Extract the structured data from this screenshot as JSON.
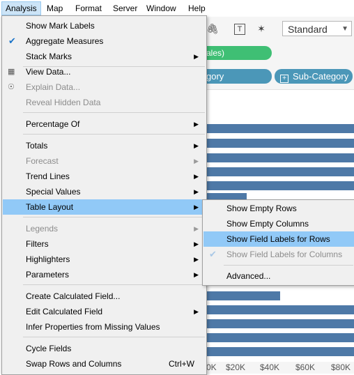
{
  "menubar": {
    "items": [
      {
        "label": "Analysis",
        "active": true
      },
      {
        "label": "Map"
      },
      {
        "label": "Format"
      },
      {
        "label": "Server"
      },
      {
        "label": "Window"
      },
      {
        "label": "Help"
      }
    ]
  },
  "toolbar": {
    "standard_select": "Standard"
  },
  "shelves": {
    "green_pill": "ales)",
    "category_pill": "gory",
    "subcategory_pill": "Sub-Category"
  },
  "axis_ticks": [
    "0K",
    "$20K",
    "$40K",
    "$60K",
    "$80K"
  ],
  "analysis_menu": {
    "items": [
      {
        "label": "Show Mark Labels"
      },
      {
        "label": "Aggregate Measures",
        "checked": true
      },
      {
        "label": "Stack Marks",
        "submenu": true
      },
      {
        "label": "View Data...",
        "icon": "table-icon"
      },
      {
        "label": "Explain Data...",
        "disabled": true,
        "icon": "lightbulb-icon"
      },
      {
        "label": "Reveal Hidden Data",
        "disabled": true
      },
      {
        "label": "Percentage Of",
        "submenu": true
      },
      {
        "label": "Totals",
        "submenu": true
      },
      {
        "label": "Forecast",
        "submenu": true,
        "disabled": true
      },
      {
        "label": "Trend Lines",
        "submenu": true
      },
      {
        "label": "Special Values",
        "submenu": true
      },
      {
        "label": "Table Layout",
        "submenu": true,
        "highlighted": true
      },
      {
        "label": "Legends",
        "submenu": true,
        "disabled": true
      },
      {
        "label": "Filters",
        "submenu": true
      },
      {
        "label": "Highlighters",
        "submenu": true
      },
      {
        "label": "Parameters",
        "submenu": true
      },
      {
        "label": "Create Calculated Field..."
      },
      {
        "label": "Edit Calculated Field",
        "submenu": true
      },
      {
        "label": "Infer Properties from Missing Values"
      },
      {
        "label": "Cycle Fields"
      },
      {
        "label": "Swap Rows and Columns",
        "shortcut": "Ctrl+W"
      }
    ]
  },
  "table_layout_menu": {
    "items": [
      {
        "label": "Show Empty Rows"
      },
      {
        "label": "Show Empty Columns"
      },
      {
        "label": "Show Field Labels for Rows",
        "highlighted": true
      },
      {
        "label": "Show Field Labels for Columns",
        "checked": true,
        "disabled": true
      },
      {
        "label": "Advanced..."
      }
    ]
  }
}
